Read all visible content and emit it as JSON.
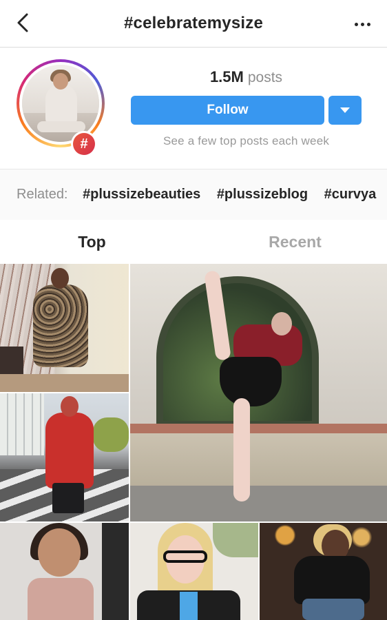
{
  "header": {
    "title": "#celebratemysize",
    "back_icon": "chevron-left-icon",
    "more_icon": "more-horizontal-icon"
  },
  "hashtag": {
    "post_count": "1.5M",
    "post_label": "posts",
    "follow_label": "Follow",
    "subtext": "See a few top posts each week",
    "badge_symbol": "#"
  },
  "related": {
    "label": "Related:",
    "tags": [
      "#plussizebeauties",
      "#plussizeblog",
      "#curvya"
    ]
  },
  "tabs": {
    "top": "Top",
    "recent": "Recent",
    "active": "Top"
  },
  "colors": {
    "accent": "#3897f0",
    "text": "#262626",
    "muted": "#8e8e8e"
  }
}
